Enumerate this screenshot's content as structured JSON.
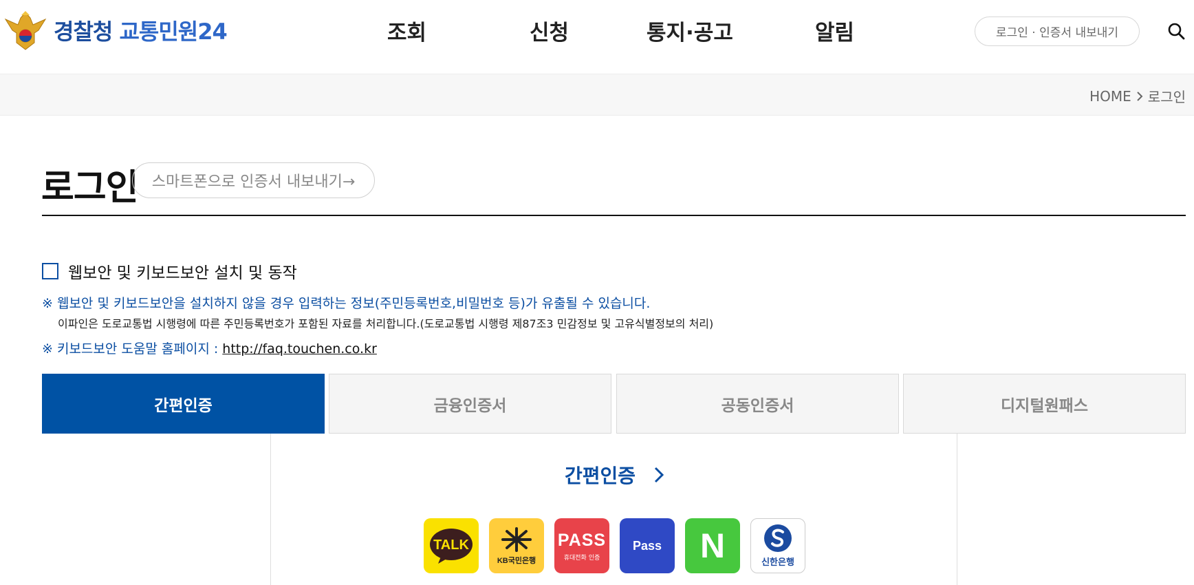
{
  "header": {
    "logo_text_1": "경찰청",
    "logo_text_2": "교통민원24",
    "nav": [
      "조회",
      "신청",
      "통지·공고",
      "알림"
    ],
    "login_button": "로그인  · 인증서 내보내기"
  },
  "breadcrumb": {
    "home": "HOME",
    "current": "로그인"
  },
  "page": {
    "title": "로그인",
    "export_button": "스마트폰으로 인증서 내보내기→"
  },
  "security": {
    "checkbox_label": "웹보안 및 키보드보안 설치 및 동작",
    "warning": "※ 웹보안 및 키보드보안을 설치하지 않을 경우 입력하는 정보(주민등록번호,비밀번호 등)가 유출될 수 있습니다.",
    "notice": "이파인은 도로교통법 시행령에 따른 주민등록번호가 포함된 자료를 처리합니다.(도로교통법 시행령 제87조3 민감정보 및 고유식별정보의 처리)",
    "help_prefix": "※ 키보드보안 도움말 홈페이지 : ",
    "help_link": "http://faq.touchen.co.kr"
  },
  "tabs": [
    {
      "label": "간편인증",
      "active": true
    },
    {
      "label": "금융인증서",
      "active": false
    },
    {
      "label": "공동인증서",
      "active": false
    },
    {
      "label": "디지털원패스",
      "active": false
    }
  ],
  "panel": {
    "title": "간편인증",
    "providers": [
      {
        "name": "kakao-icon",
        "text": "TALK"
      },
      {
        "name": "kb-icon",
        "text": "KB국민은행"
      },
      {
        "name": "pass-icon",
        "text": "PASS",
        "subtext": "휴대전화 인증"
      },
      {
        "name": "pass-blue-icon",
        "text": "Pass"
      },
      {
        "name": "naver-icon",
        "text": "N"
      },
      {
        "name": "shinhan-icon",
        "text": "신한은행"
      }
    ]
  },
  "colors": {
    "primary": "#0052a4",
    "link_blue": "#0b4ea2"
  }
}
